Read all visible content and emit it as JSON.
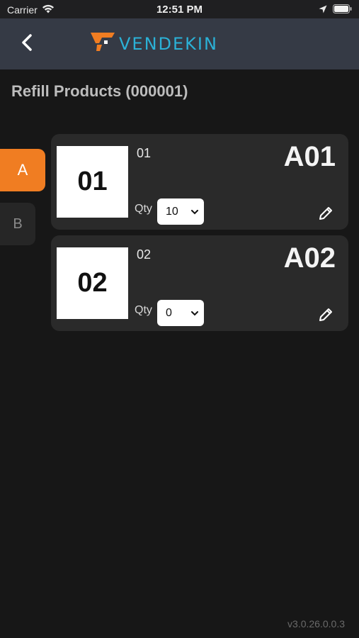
{
  "status_bar": {
    "carrier": "Carrier",
    "time": "12:51 PM"
  },
  "header": {
    "logo_text": "VENDEKIN",
    "accent_color": "#f07d22",
    "logo_color": "#2bb1d6"
  },
  "page": {
    "title": "Refill Products (000001)"
  },
  "tabs": [
    {
      "label": "A",
      "selected": true
    },
    {
      "label": "B",
      "selected": false
    }
  ],
  "products": [
    {
      "thumb_text": "01",
      "name": "01",
      "slot": "A01",
      "qty_label": "Qty",
      "qty": "10"
    },
    {
      "thumb_text": "02",
      "name": "02",
      "slot": "A02",
      "qty_label": "Qty",
      "qty": "0"
    }
  ],
  "footer": {
    "version": "v3.0.26.0.0.3"
  },
  "icons": {
    "back": "chevron-left-icon",
    "edit": "pencil-icon",
    "wifi": "wifi-icon",
    "location": "location-arrow-icon",
    "battery": "battery-icon"
  }
}
